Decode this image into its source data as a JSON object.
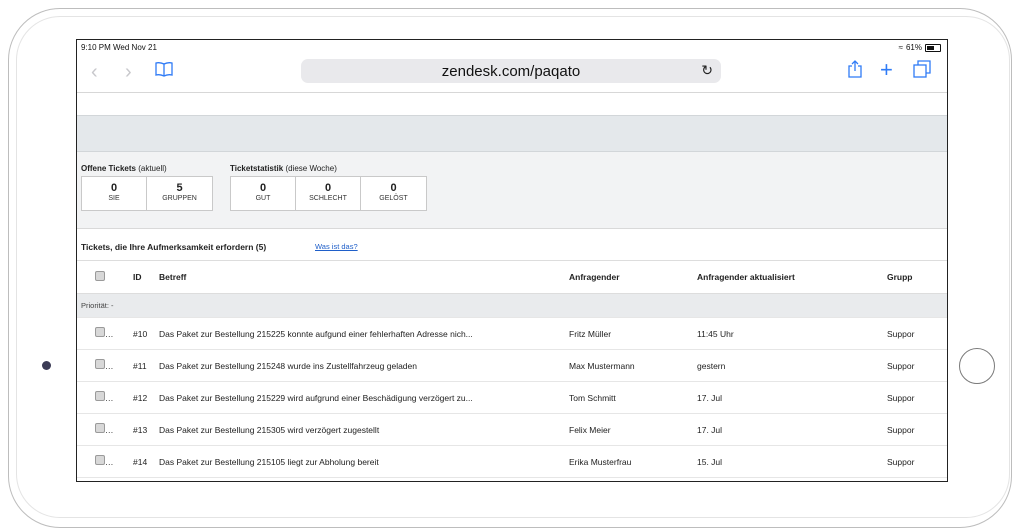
{
  "statusbar": {
    "time": "9:10 PM  Wed Nov 21",
    "battery": "61%"
  },
  "browser": {
    "url": "zendesk.com/paqato"
  },
  "icons": {
    "back": "chevron-left-icon",
    "forward": "chevron-right-icon",
    "bookmarks": "book-icon",
    "reload": "reload-icon",
    "share": "share-icon",
    "new_tab": "plus-icon",
    "tabs": "tabs-icon"
  },
  "open_tickets": {
    "title": "Offene Tickets",
    "qualifier": " (aktuell)",
    "boxes": [
      {
        "value": "0",
        "label": "SIE"
      },
      {
        "value": "5",
        "label": "GRUPPEN"
      }
    ]
  },
  "ticket_stats": {
    "title": "Ticketstatistik",
    "qualifier": " (diese Woche)",
    "boxes": [
      {
        "value": "0",
        "label": "GUT"
      },
      {
        "value": "0",
        "label": "SCHLECHT"
      },
      {
        "value": "0",
        "label": "GELÖST"
      }
    ]
  },
  "tickets_section": {
    "title": "Tickets, die Ihre Aufmerksamkeit erfordern (5)",
    "help_link": "Was ist das?"
  },
  "table": {
    "headers": {
      "id": "ID",
      "subject": "Betreff",
      "requester": "Anfragender",
      "updated": "Anfragender aktualisiert",
      "group": "Grupp"
    },
    "priority_label": "Priorität: -",
    "rows": [
      {
        "badge": "N",
        "id": "#10",
        "subject": "Das Paket zur Bestellung 215225 konnte aufgund einer fehlerhaften Adresse nich...",
        "requester": "Fritz Müller",
        "updated": "11:45 Uhr",
        "group": "Suppor"
      },
      {
        "badge": "N",
        "id": "#11",
        "subject": "Das Paket zur Bestellung 215248 wurde ins Zustellfahrzeug geladen",
        "requester": "Max Mustermann",
        "updated": "gestern",
        "group": "Suppor"
      },
      {
        "badge": "N",
        "id": "#12",
        "subject": "Das Paket zur Bestellung 215229 wird aufgrund einer Beschädigung verzögert zu...",
        "requester": "Tom Schmitt",
        "updated": "17. Jul",
        "group": "Suppor"
      },
      {
        "badge": "N",
        "id": "#13",
        "subject": "Das Paket zur Bestellung 215305 wird verzögert zugestellt",
        "requester": "Felix Meier",
        "updated": "17. Jul",
        "group": "Suppor"
      },
      {
        "badge": "N",
        "id": "#14",
        "subject": "Das Paket zur Bestellung 215105 liegt zur Abholung bereit",
        "requester": "Erika Musterfrau",
        "updated": "15. Jul",
        "group": "Suppor"
      }
    ]
  }
}
